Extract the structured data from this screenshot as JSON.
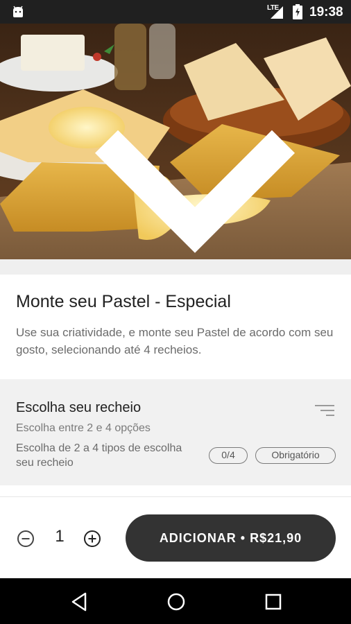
{
  "status_bar": {
    "network_label": "LTE",
    "time": "19:38",
    "icons": [
      "android-icon",
      "signal-icon",
      "battery-charging-icon"
    ]
  },
  "hero": {
    "image_subject": "pastel de queijo",
    "collapse_icon": "chevron-down-icon"
  },
  "product": {
    "title": "Monte seu Pastel - Especial",
    "description": "Use sua criatividade, e monte seu Pastel de acordo com seu gosto, selecionando até 4 recheios."
  },
  "options": {
    "title": "Escolha seu recheio",
    "subtitle": "Escolha entre 2 e 4 opções",
    "description": "Escolha de 2 a 4 tipos de escolha seu recheio",
    "count_badge": "0/4",
    "required_badge": "Obrigatório",
    "icon": "filter-list-icon"
  },
  "footer": {
    "quantity": "1",
    "add_button_label": "ADICIONAR • R$21,90"
  },
  "colors": {
    "status_bar": "#202020",
    "button_bg": "#333333",
    "section_bg": "#f1f1f1",
    "nav_bar": "#000000"
  }
}
